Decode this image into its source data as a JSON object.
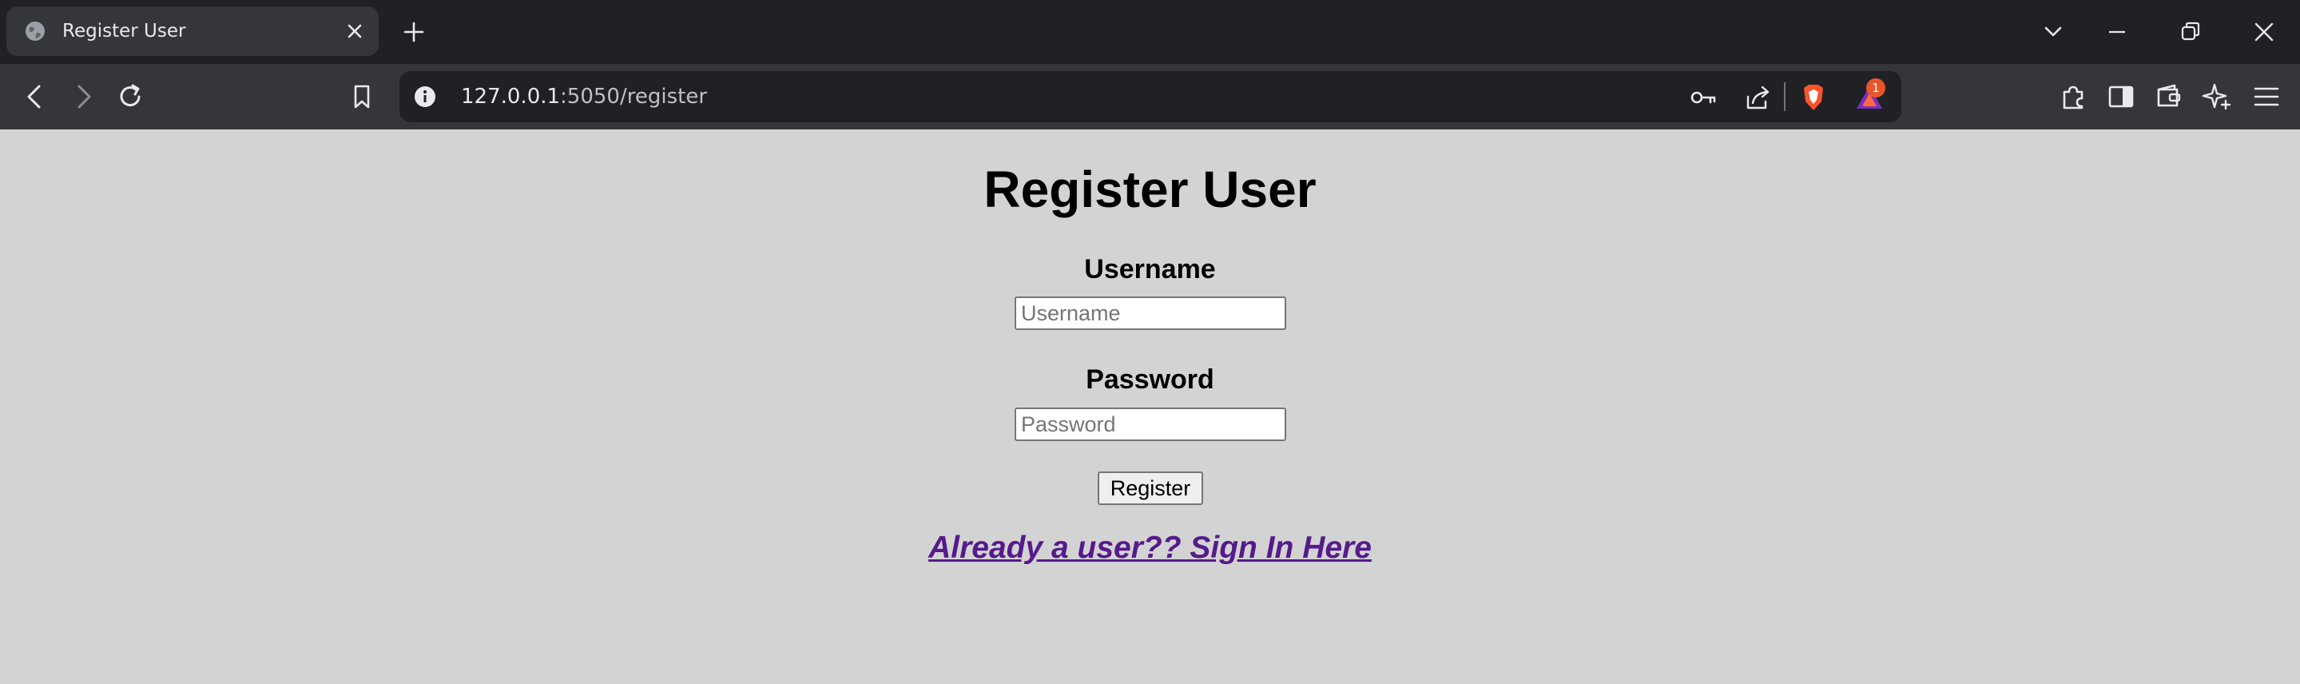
{
  "browser": {
    "tab": {
      "title": "Register User",
      "favicon": "globe-icon"
    },
    "url": {
      "host": "127.0.0.1",
      "rest": ":5050/register"
    },
    "notifications_badge": "1",
    "icons": [
      "back-icon",
      "forward-icon",
      "reload-icon",
      "bookmark-icon",
      "info-icon",
      "key-icon",
      "share-icon",
      "brave-shields-icon",
      "brave-rewards-icon",
      "extensions-icon",
      "sidebar-icon",
      "wallet-icon",
      "leo-ai-icon",
      "menu-icon",
      "tab-search-icon",
      "minimize-icon",
      "restore-icon",
      "close-icon"
    ]
  },
  "page": {
    "title": "Register User",
    "username": {
      "label": "Username",
      "placeholder": "Username",
      "value": ""
    },
    "password": {
      "label": "Password",
      "placeholder": "Password",
      "value": ""
    },
    "submit_label": "Register",
    "signin_link": "Already a user?? Sign In Here"
  },
  "colors": {
    "page_background": "#d3d3d3",
    "link": "#551a8b",
    "chrome_dark": "#202124",
    "chrome_toolbar": "#35363a",
    "badge": "#e8552b"
  }
}
